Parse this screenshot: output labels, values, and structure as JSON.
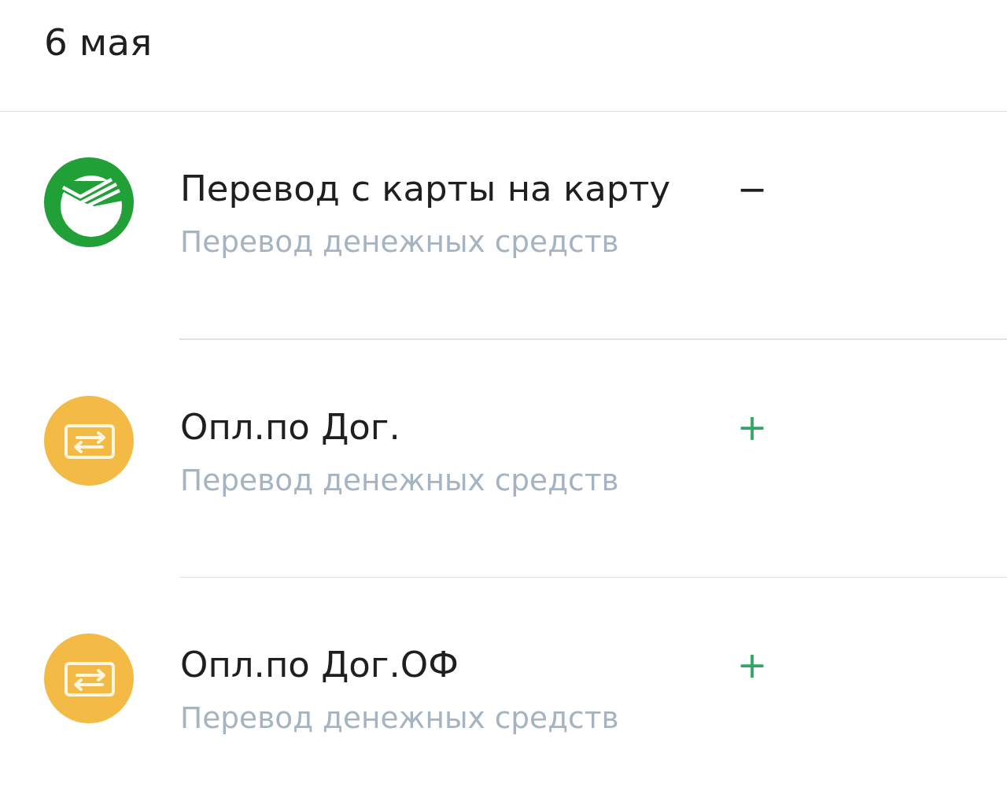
{
  "date_header": "6 мая",
  "transactions": [
    {
      "kind": "bank",
      "title": "Перевод с карты на карту",
      "category": "Перевод денежных средств",
      "amount": {
        "text": "−",
        "color": "#1f1f1f"
      }
    },
    {
      "kind": "transfer",
      "title": "Опл.по Дог.",
      "category": "Перевод денежных средств",
      "amount": {
        "text": "+",
        "color": "#2fa862"
      }
    },
    {
      "kind": "transfer",
      "title": "Опл.по Дог.ОФ",
      "category": "Перевод денежных средств",
      "amount": {
        "text": "+",
        "color": "#2fa862"
      }
    }
  ]
}
